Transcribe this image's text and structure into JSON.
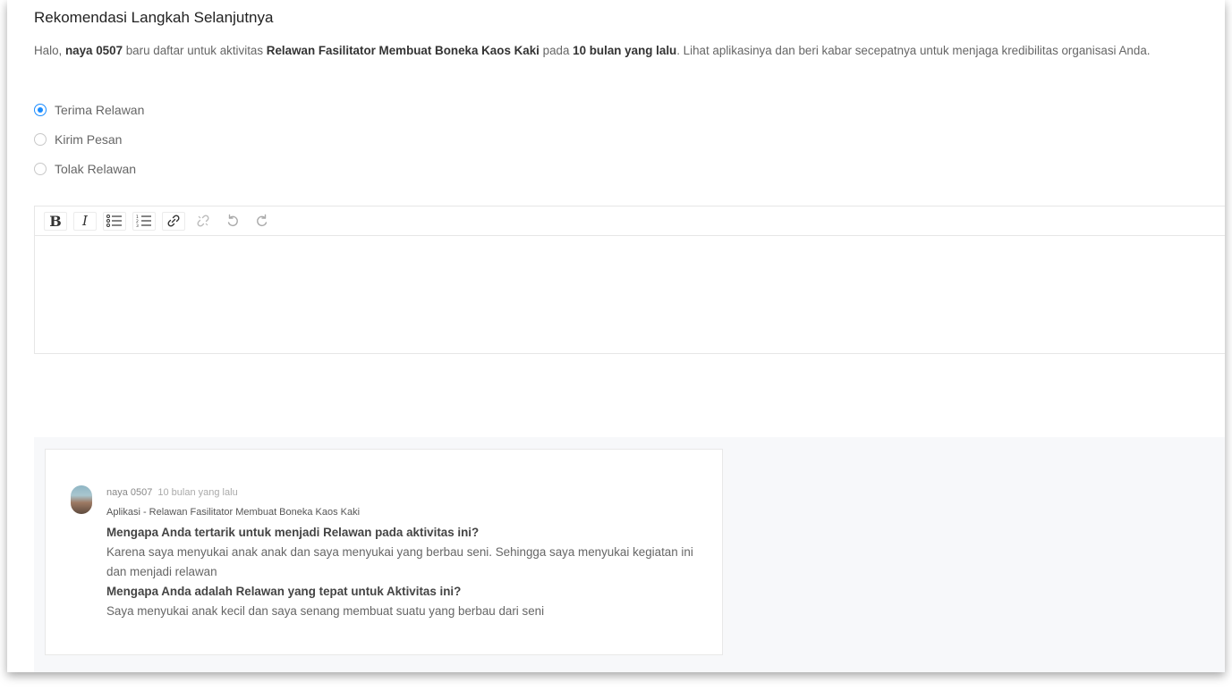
{
  "section": {
    "title": "Rekomendasi Langkah Selanjutnya",
    "intro": {
      "prefix": "Halo, ",
      "user": "naya 0507",
      "mid1": " baru daftar untuk aktivitas ",
      "activity": "Relawan Fasilitator Membuat Boneka Kaos Kaki",
      "mid2": " pada ",
      "time": "10 bulan yang lalu",
      "suffix": ". Lihat aplikasinya dan beri kabar secepatnya untuk menjaga kredibilitas organisasi Anda."
    }
  },
  "actions": {
    "selected": "terima",
    "options": [
      {
        "id": "terima",
        "label": "Terima Relawan"
      },
      {
        "id": "pesan",
        "label": "Kirim Pesan"
      },
      {
        "id": "tolak",
        "label": "Tolak Relawan"
      }
    ]
  },
  "editor": {
    "toolbar": [
      {
        "icon": "bold-icon",
        "glyph": "B"
      },
      {
        "icon": "italic-icon",
        "glyph": "I"
      },
      {
        "icon": "bullet-list-icon"
      },
      {
        "icon": "numbered-list-icon"
      },
      {
        "icon": "link-icon"
      },
      {
        "icon": "unlink-icon",
        "disabled": true
      },
      {
        "icon": "undo-icon",
        "disabled": true
      },
      {
        "icon": "redo-icon",
        "disabled": true
      }
    ],
    "content": ""
  },
  "application": {
    "user": "naya 0507",
    "time": "10 bulan yang lalu",
    "subtitle": "Aplikasi - Relawan Fasilitator Membuat Boneka Kaos Kaki",
    "qa": [
      {
        "question": "Mengapa Anda tertarik untuk menjadi Relawan pada aktivitas ini?",
        "answer": "Karena saya menyukai anak anak dan saya menyukai yang berbau seni. Sehingga saya menyukai kegiatan ini dan menjadi relawan"
      },
      {
        "question": "Mengapa Anda adalah Relawan yang tepat untuk Aktivitas ini?",
        "answer": "Saya menyukai anak kecil dan saya senang membuat suatu yang berbau dari seni"
      }
    ]
  },
  "colors": {
    "accent": "#1a8cff",
    "panel_bg": "#f7f8fa"
  }
}
